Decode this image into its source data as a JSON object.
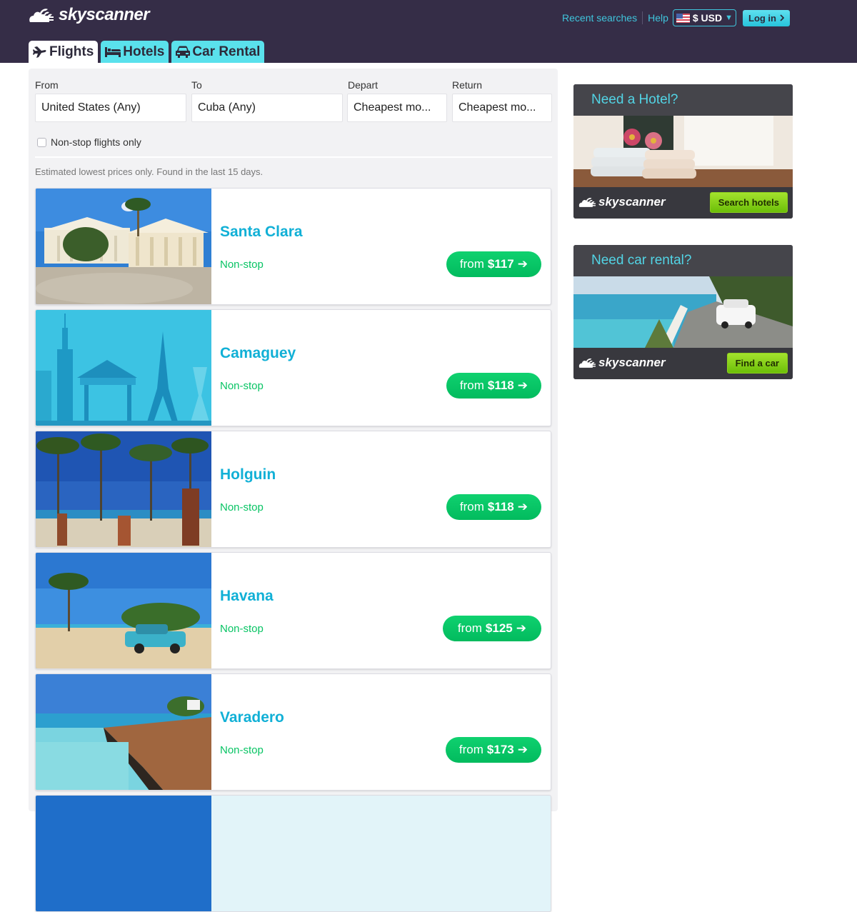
{
  "header": {
    "brand": "skyscanner",
    "tabs": [
      {
        "label": "Flights",
        "icon": "plane-icon",
        "active": true
      },
      {
        "label": "Hotels",
        "icon": "bed-icon",
        "active": false
      },
      {
        "label": "Car Rental",
        "icon": "car-icon",
        "active": false
      }
    ],
    "links": {
      "recent_searches": "Recent searches",
      "help": "Help"
    },
    "currency": {
      "flag": "us-flag-icon",
      "label": "$ USD"
    },
    "login_label": "Log in"
  },
  "search": {
    "from": {
      "label": "From",
      "value": "United States (Any)"
    },
    "to": {
      "label": "To",
      "value": "Cuba (Any)"
    },
    "depart": {
      "label": "Depart",
      "value": "Cheapest mo..."
    },
    "return": {
      "label": "Return",
      "value": "Cheapest mo..."
    },
    "nonstop_label": "Non-stop flights only",
    "nonstop_checked": false,
    "note": "Estimated lowest prices only. Found in the last 15 days."
  },
  "results": [
    {
      "city": "Santa Clara",
      "stops": "Non-stop",
      "from": "from",
      "price": "$117"
    },
    {
      "city": "Camaguey",
      "stops": "Non-stop",
      "from": "from",
      "price": "$118"
    },
    {
      "city": "Holguin",
      "stops": "Non-stop",
      "from": "from",
      "price": "$118"
    },
    {
      "city": "Havana",
      "stops": "Non-stop",
      "from": "from",
      "price": "$125"
    },
    {
      "city": "Varadero",
      "stops": "Non-stop",
      "from": "from",
      "price": "$173"
    }
  ],
  "ads": [
    {
      "title": "Need a Hotel?",
      "brand": "skyscanner",
      "button": "Search hotels"
    },
    {
      "title": "Need car rental?",
      "brand": "skyscanner",
      "button": "Find a car"
    }
  ],
  "colors": {
    "topbar": "#352d47",
    "accent_cyan": "#5ae1ec",
    "city_blue": "#11b0d6",
    "price_green": "#02bb5e",
    "ad_button_green": "#8ed020"
  }
}
